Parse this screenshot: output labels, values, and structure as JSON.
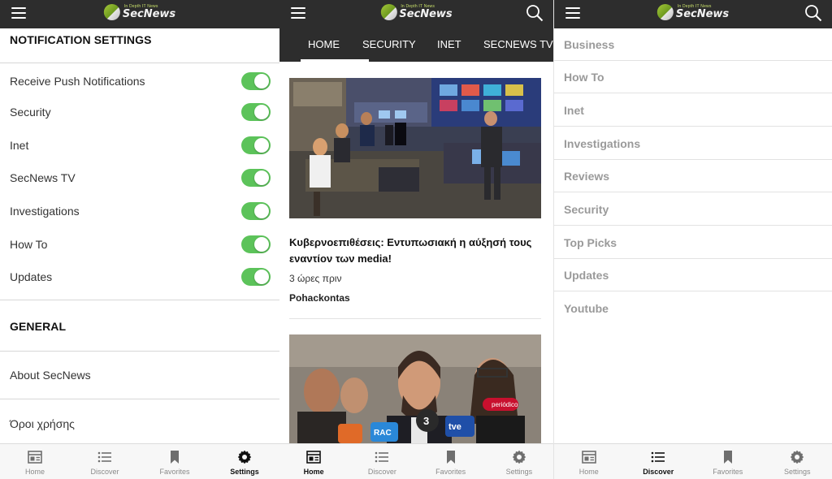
{
  "brand": {
    "name": "SecNews",
    "tagline": "In Depth IT News"
  },
  "settings_screen": {
    "notifications_title": "NOTIFICATION SETTINGS",
    "toggles": [
      {
        "label": "Receive Push Notifications",
        "on": true
      },
      {
        "label": "Security",
        "on": true
      },
      {
        "label": "Inet",
        "on": true
      },
      {
        "label": "SecNews TV",
        "on": true
      },
      {
        "label": "Investigations",
        "on": true
      },
      {
        "label": "How To",
        "on": true
      },
      {
        "label": "Updates",
        "on": true
      }
    ],
    "general_title": "GENERAL",
    "general_items": [
      "About SecNews",
      "Όροι χρήσης"
    ]
  },
  "news_screen": {
    "tabs": [
      "HOME",
      "SECURITY",
      "INET",
      "SECNEWS TV"
    ],
    "active_tab": "HOME",
    "article": {
      "title": "Κυβερνοεπιθέσεις: Εντυπωσιακή η αύξησή τους εναντίον των media!",
      "time": "3 ώρες πριν",
      "author": "Pohackontas"
    },
    "second_article_microphone_labels": [
      "3",
      "tve",
      "RAC",
      "periódico"
    ]
  },
  "discover_screen": {
    "categories": [
      "Business",
      "How To",
      "Inet",
      "Investigations",
      "Reviews",
      "Security",
      "Top Picks",
      "Updates",
      "Youtube"
    ]
  },
  "bottom_nav": {
    "items": [
      {
        "label": "Home",
        "icon": "home-icon"
      },
      {
        "label": "Discover",
        "icon": "list-icon"
      },
      {
        "label": "Favorites",
        "icon": "bookmark-icon"
      },
      {
        "label": "Settings",
        "icon": "gear-icon"
      }
    ],
    "active": {
      "settings_screen": "Settings",
      "news_screen": "Home",
      "discover_screen": "Discover"
    }
  },
  "colors": {
    "topbar": "#2d2d2d",
    "toggle_on": "#5cc35a",
    "category_text": "#9a9a9a",
    "logo_accent": "#a7c93b"
  }
}
